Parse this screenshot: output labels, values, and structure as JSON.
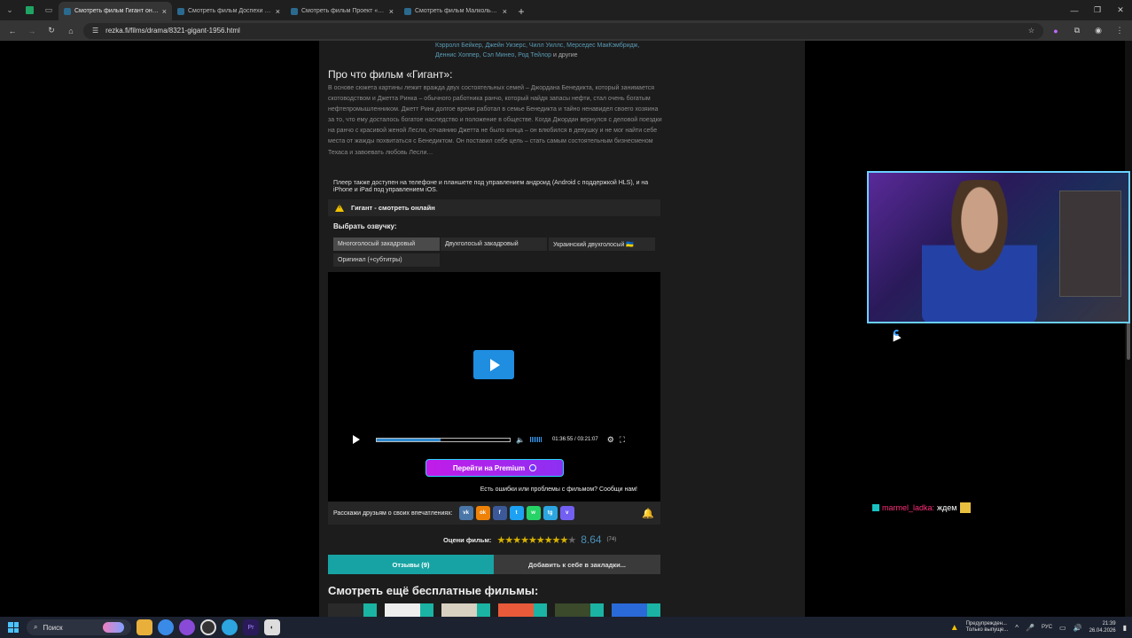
{
  "browser": {
    "tabs": [
      {
        "label": "Смотреть фильм Гигант онлайн",
        "active": true
      },
      {
        "label": "Смотреть фильм Доспехи Бога",
        "active": false
      },
      {
        "label": "Смотреть фильм Проект «Ад»",
        "active": false
      },
      {
        "label": "Смотреть фильм Малкольм Икс",
        "active": false
      }
    ],
    "url": "rezka.fi/films/drama/8321-gigant-1956.html"
  },
  "page": {
    "cast_line1": "Кэрролл Бейкер, Джейн Уизерс, Чилл Уиллс, Мерседес МакКэмбридж,",
    "cast_line2": "Деннис Хоппер, Сэл Минео, Род Тейлор",
    "cast_tail": " и другие",
    "about_title": "Про что фильм «Гигант»:",
    "about_text": "В основе сюжета картины лежит вражда двух состоятельных семей – Джордана Бенедикта, который занимается скотоводством и Джетта Ринка – обычного работника ранчо, который найдя запасы нефти, стал очень богатым нефтепромышленником. Джетт Ринк долгое время работал в семье Бенедикта и тайно ненавидел своего хозяина за то, что ему досталось богатое наследство и положение в обществе. Когда Джордан вернулся с деловой поездки на ранчо с красивой женой Лесли, отчаянию Джетта не было конца – он влюбился в девушку и не мог найти себе места от жажды похвитаться с Бенедиктом. Он поставил себе цель – стать самым состоятельным бизнесменом Техаса и завоевать любовь Лесли…",
    "player_note": "Плеер также доступен на телефоне и планшете под управлением андроид (Android с поддержкой HLS), и на iPhone и iPad под управлением iOS.",
    "player_title": "Гигант - смотреть онлайн",
    "dub_heading": "Выбрать озвучку:",
    "dubs": [
      "Многоголосый закадровый",
      "Двухголосый закадровый",
      "Украинский двухголосый 🇺🇦",
      "Оригинал (+субтитры)"
    ],
    "time": "01:36:55 / 03:21:07",
    "progress": 0.48,
    "premium_label": "Перейти на Premium",
    "report_text": "Есть ошибки или проблемы с фильмом? Сообщи нам!",
    "share_label": "Расскажи друзьям о своих впечатлениях:",
    "social": [
      {
        "name": "vk",
        "glyph": "vk",
        "color": "#4a76a8"
      },
      {
        "name": "ok",
        "glyph": "ok",
        "color": "#ee8208"
      },
      {
        "name": "fb",
        "glyph": "f",
        "color": "#3b5998"
      },
      {
        "name": "tw",
        "glyph": "t",
        "color": "#1da1f2"
      },
      {
        "name": "wa",
        "glyph": "w",
        "color": "#25d366"
      },
      {
        "name": "tg",
        "glyph": "tg",
        "color": "#2ca5e0"
      },
      {
        "name": "vb",
        "glyph": "v",
        "color": "#7360f2"
      }
    ],
    "rating_label": "Оцени фильм:",
    "rating_score": "8.64",
    "rating_votes": "(74)",
    "stars_filled": 9,
    "stars_total": 10,
    "reviews_btn": "Отзывы (9)",
    "bookmark_btn": "Добавить к себе в закладки...",
    "more_title": "Смотреть ещё бесплатные фильмы:"
  },
  "overlay": {
    "chat_user": "marmel_ladka:",
    "chat_msg": "ждем"
  },
  "taskbar": {
    "search": "Поиск",
    "warning_title": "Предупрежден...",
    "warning_sub": "Только выпуще...",
    "lang": "РУС",
    "time": "21:39",
    "date": "26.04.2026"
  }
}
